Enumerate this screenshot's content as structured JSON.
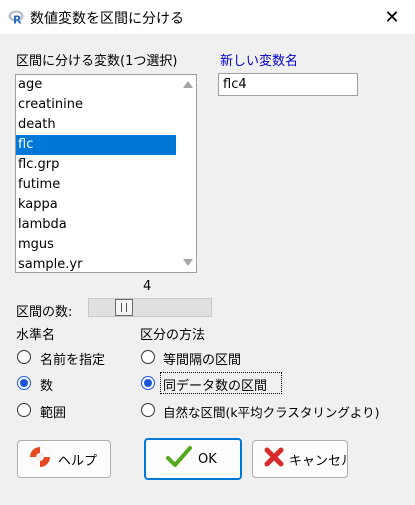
{
  "window": {
    "title": "数値変数を区間に分ける",
    "app_icon": "r-logo-icon",
    "close_glyph": "✕"
  },
  "variable_list": {
    "label": "区間に分ける変数(1つ選択)",
    "items": [
      "age",
      "creatinine",
      "death",
      "flc",
      "flc.grp",
      "futime",
      "kappa",
      "lambda",
      "mgus",
      "sample.yr"
    ],
    "selected": "flc"
  },
  "new_var": {
    "label": "新しい変数名",
    "value": "flc4"
  },
  "bins": {
    "label": "区間の数:",
    "value": "4",
    "slider_fraction": 0.25
  },
  "level_names": {
    "title": "水準名",
    "options": [
      "名前を指定",
      "数",
      "範囲"
    ],
    "selected": "数"
  },
  "method": {
    "title": "区分の方法",
    "options": [
      "等間隔の区間",
      "同データ数の区間",
      "自然な区間(k平均クラスタリングより)"
    ],
    "selected": "同データ数の区間"
  },
  "buttons": {
    "help": {
      "label": "ヘルプ",
      "icon": "lifebuoy-icon"
    },
    "ok": {
      "label": "OK",
      "icon": "checkmark-icon"
    },
    "cancel": {
      "label": "キャンセル",
      "icon": "red-x-icon"
    }
  },
  "colors": {
    "selection": "#0078d7",
    "label_blue": "#0000cc",
    "radio_fill": "#1a56db",
    "ok_check": "#58a81d",
    "cancel_x": "#d92b2b"
  }
}
